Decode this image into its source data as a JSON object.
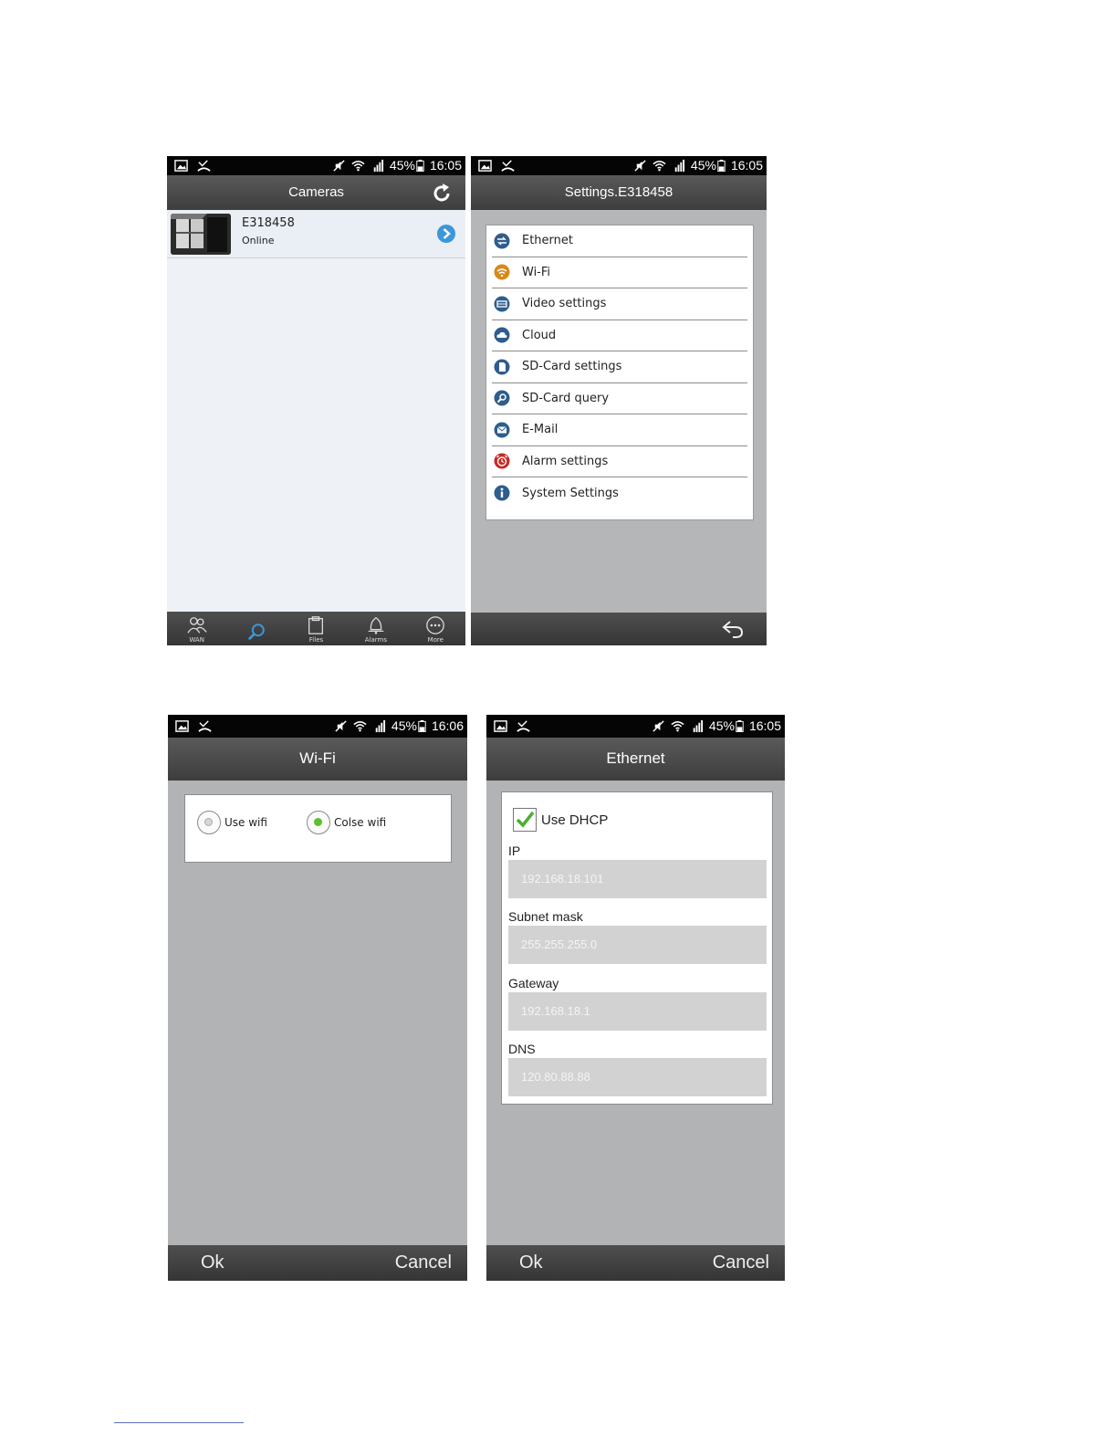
{
  "status_bars": {
    "cameras": {
      "battery": "45%",
      "time": "16:05"
    },
    "settings": {
      "battery": "45%",
      "time": "16:05"
    },
    "wifi": {
      "battery": "45%",
      "time": "16:06"
    },
    "ethernet": {
      "battery": "45%",
      "time": "16:05"
    }
  },
  "cameras_screen": {
    "title": "Cameras",
    "camera": {
      "name": "E318458",
      "status": "Online"
    },
    "tabs": [
      {
        "label": "WAN",
        "icon": "people-icon"
      },
      {
        "label": "",
        "icon": "search-icon"
      },
      {
        "label": "Files",
        "icon": "clipboard-icon"
      },
      {
        "label": "Alarms",
        "icon": "bell-icon"
      },
      {
        "label": "More",
        "icon": "more-icon"
      }
    ]
  },
  "settings_screen": {
    "title": "Settings.E318458",
    "items": [
      {
        "label": "Ethernet",
        "icon": "ethernet-icon",
        "color": "#2f5d8c"
      },
      {
        "label": "Wi-Fi",
        "icon": "wifi-icon",
        "color": "#d58a1c"
      },
      {
        "label": "Video settings",
        "icon": "video-icon",
        "color": "#2f5d8c"
      },
      {
        "label": "Cloud",
        "icon": "cloud-icon",
        "color": "#2f5d8c"
      },
      {
        "label": "SD-Card settings",
        "icon": "sd-card-icon",
        "color": "#2f5d8c"
      },
      {
        "label": "SD-Card query",
        "icon": "search-icon",
        "color": "#2f5d8c"
      },
      {
        "label": "E-Mail",
        "icon": "mail-icon",
        "color": "#2f5d8c"
      },
      {
        "label": "Alarm settings",
        "icon": "alarm-clock-icon",
        "color": "#c62a22"
      },
      {
        "label": "System Settings",
        "icon": "info-icon",
        "color": "#2f5d8c"
      }
    ]
  },
  "wifi_screen": {
    "title": "Wi-Fi",
    "options": [
      {
        "label": "Use wifi",
        "selected": false
      },
      {
        "label": "Colse wifi",
        "selected": true
      }
    ],
    "ok_label": "Ok",
    "cancel_label": "Cancel"
  },
  "ethernet_screen": {
    "title": "Ethernet",
    "dhcp_label": "Use DHCP",
    "dhcp_checked": true,
    "fields": [
      {
        "label": "IP",
        "value": "192.168.18.101"
      },
      {
        "label": "Subnet mask",
        "value": "255.255.255.0"
      },
      {
        "label": "Gateway",
        "value": "192.168.18.1"
      },
      {
        "label": "DNS",
        "value": "120.80.88.88"
      }
    ],
    "ok_label": "Ok",
    "cancel_label": "Cancel"
  },
  "colors": {
    "accent_blue": "#3b97d9",
    "check_green": "#4caf2f",
    "radio_green": "#5cc02f"
  }
}
